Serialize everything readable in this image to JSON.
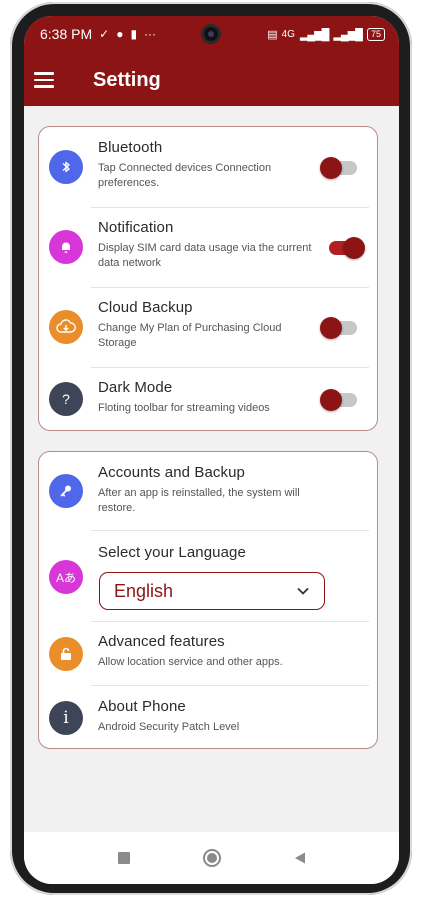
{
  "status_bar": {
    "time": "6:38 PM",
    "icons": [
      "check-download-icon",
      "whatsapp-icon",
      "trash-icon",
      "more-dots-icon"
    ],
    "right_text": "4G",
    "battery": "75"
  },
  "header": {
    "title": "Setting",
    "menu_icon": "hamburger-icon"
  },
  "card1": {
    "items": [
      {
        "title": "Bluetooth",
        "subtitle": "Tap Connected devices Connection preferences.",
        "icon": "bluetooth-icon",
        "color": "#4f67e8",
        "toggle_on": false
      },
      {
        "title": "Notification",
        "subtitle": "Display SIM card data usage via the current data network",
        "icon": "bell-icon",
        "color": "#d936d9",
        "toggle_on": true
      },
      {
        "title": "Cloud Backup",
        "subtitle": "Change My Plan of Purchasing Cloud Storage",
        "icon": "cloud-download-icon",
        "color": "#ea8d2b",
        "toggle_on": false
      },
      {
        "title": "Dark Mode",
        "subtitle": "Floting toolbar for streaming videos",
        "icon": "question-icon",
        "color": "#3d4556",
        "toggle_on": false
      }
    ]
  },
  "card2": {
    "items": [
      {
        "title": "Accounts and Backup",
        "subtitle": "After an app is reinstalled, the system will restore.",
        "icon": "key-icon",
        "color": "#4f67e8"
      },
      {
        "title": "Select your Language",
        "icon": "translate-icon",
        "color": "#d936d9",
        "selected_language": "English"
      },
      {
        "title": "Advanced features",
        "subtitle": "Allow location service and other apps.",
        "icon": "lock-icon",
        "color": "#ea8d2b"
      },
      {
        "title": "About Phone",
        "subtitle": "Android Security Patch Level",
        "icon": "info-icon",
        "color": "#3d4556"
      }
    ]
  },
  "colors": {
    "primary": "#8c1414",
    "background": "#f1f1f1"
  }
}
